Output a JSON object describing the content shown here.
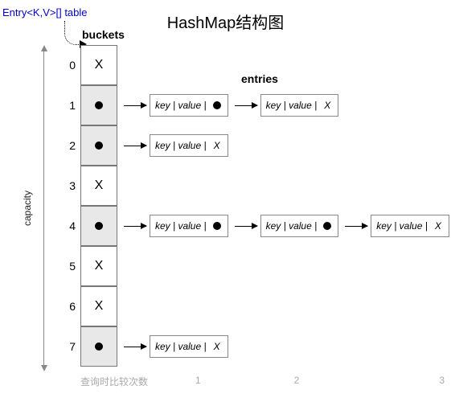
{
  "title": "HashMap结构图",
  "type_label": "Entry<K,V>[] table",
  "buckets_label": "buckets",
  "entries_label": "entries",
  "capacity_label": "capacity",
  "empty_marker": "X",
  "entry_kv": "key | value |",
  "entry_end": "X",
  "buckets": [
    {
      "index": "0",
      "filled": false,
      "chain": 0
    },
    {
      "index": "1",
      "filled": true,
      "chain": 2
    },
    {
      "index": "2",
      "filled": true,
      "chain": 1
    },
    {
      "index": "3",
      "filled": false,
      "chain": 0
    },
    {
      "index": "4",
      "filled": true,
      "chain": 3
    },
    {
      "index": "5",
      "filled": false,
      "chain": 0
    },
    {
      "index": "6",
      "filled": false,
      "chain": 0
    },
    {
      "index": "7",
      "filled": true,
      "chain": 1
    }
  ],
  "footer": {
    "label": "查询时比较次数",
    "cols": [
      "1",
      "2",
      "3"
    ]
  }
}
